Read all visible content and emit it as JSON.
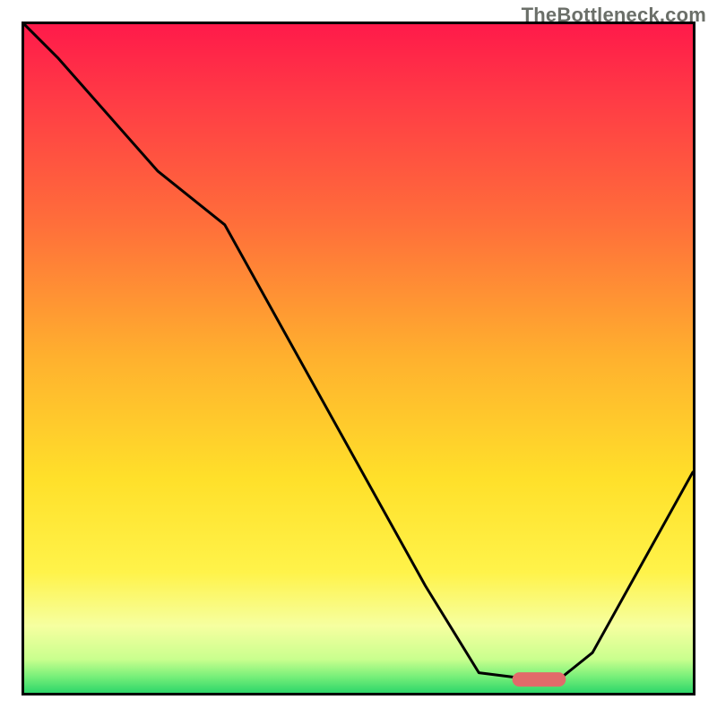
{
  "watermark": "TheBottleneck.com",
  "chart_data": {
    "type": "line",
    "title": "",
    "xlabel": "",
    "ylabel": "",
    "xlim": [
      0,
      100
    ],
    "ylim": [
      0,
      100
    ],
    "series": [
      {
        "name": "curve",
        "x": [
          0,
          5,
          20,
          30,
          60,
          68,
          76,
          80,
          85,
          100
        ],
        "values": [
          100,
          95,
          78,
          70,
          16,
          3,
          2,
          2,
          6,
          33
        ]
      }
    ],
    "marker": {
      "x_start": 73,
      "x_end": 81,
      "y": 2
    },
    "gradient_stops": [
      {
        "offset": 0.0,
        "color": "#ff1a4a"
      },
      {
        "offset": 0.12,
        "color": "#ff3d45"
      },
      {
        "offset": 0.3,
        "color": "#ff6f3a"
      },
      {
        "offset": 0.5,
        "color": "#ffb12e"
      },
      {
        "offset": 0.68,
        "color": "#ffe02a"
      },
      {
        "offset": 0.82,
        "color": "#fff34a"
      },
      {
        "offset": 0.9,
        "color": "#f6ffa0"
      },
      {
        "offset": 0.95,
        "color": "#c9ff8e"
      },
      {
        "offset": 0.975,
        "color": "#7af07a"
      },
      {
        "offset": 1.0,
        "color": "#2ed66a"
      }
    ],
    "marker_color": "#e26a6a"
  }
}
